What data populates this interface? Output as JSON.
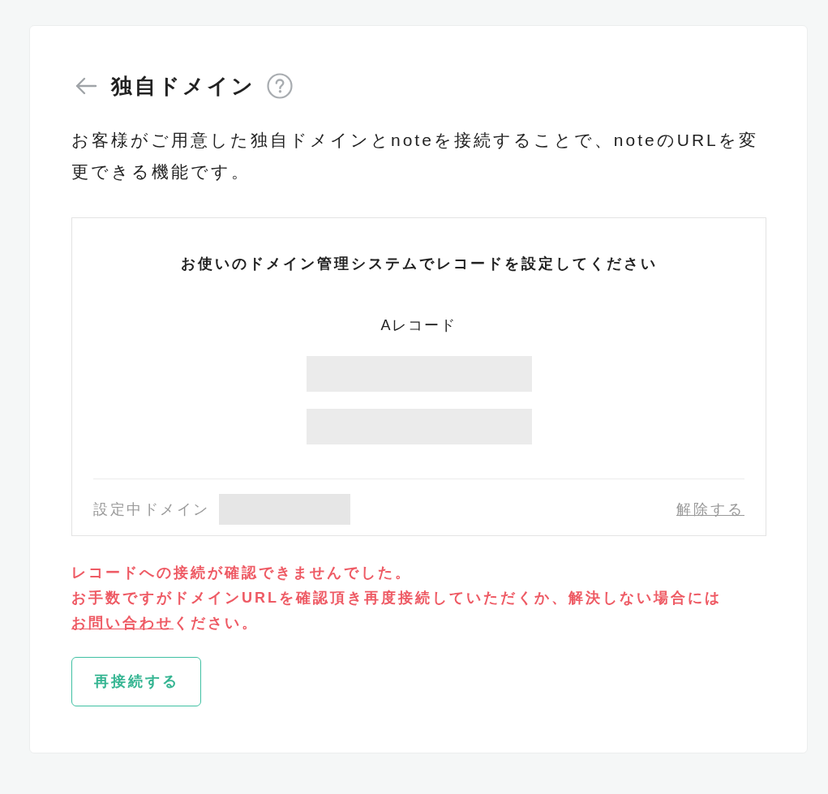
{
  "header": {
    "title": "独自ドメイン"
  },
  "description": "お客様がご用意した独自ドメインとnoteを接続することで、noteのURLを変更できる機能です。",
  "record_panel": {
    "heading": "お使いのドメイン管理システムでレコードを設定してください",
    "record_type": "Aレコード",
    "values": [
      {
        "redacted": true
      },
      {
        "redacted": true
      }
    ],
    "current_domain": {
      "label": "設定中ドメイン",
      "redacted": true
    },
    "remove_link": "解除する"
  },
  "error": {
    "message": "レコードへの接続が確認できませんでした。",
    "help": {
      "before": "お手数ですがドメインURLを確認頂き再度接続していただくか、解決しない場合には",
      "link": "お問い合わせ",
      "after": "ください。"
    }
  },
  "reconnect_button": "再接続する"
}
